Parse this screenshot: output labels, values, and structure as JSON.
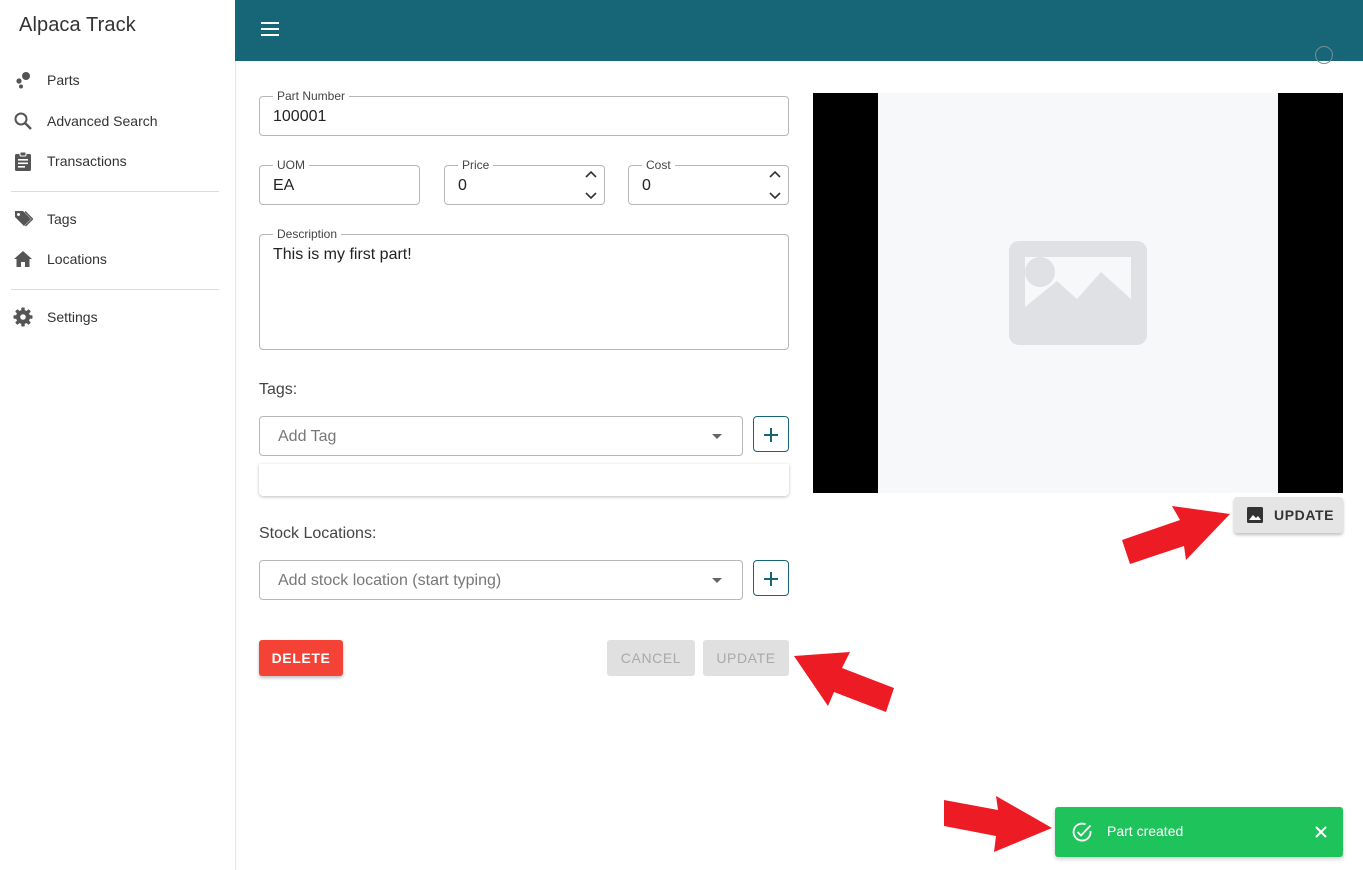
{
  "app": {
    "title": "Alpaca Track"
  },
  "sidebar": {
    "items": [
      {
        "label": "Parts",
        "icon": "parts-icon"
      },
      {
        "label": "Advanced Search",
        "icon": "search-icon"
      },
      {
        "label": "Transactions",
        "icon": "clipboard-icon"
      },
      {
        "label": "Tags",
        "icon": "tag-icon"
      },
      {
        "label": "Locations",
        "icon": "home-icon"
      },
      {
        "label": "Settings",
        "icon": "gear-icon"
      }
    ]
  },
  "form": {
    "part_number": {
      "label": "Part Number",
      "value": "100001"
    },
    "uom": {
      "label": "UOM",
      "value": "EA"
    },
    "price": {
      "label": "Price",
      "value": "0"
    },
    "cost": {
      "label": "Cost",
      "value": "0"
    },
    "description": {
      "label": "Description",
      "value": "This is my first part!"
    },
    "tags_label": "Tags:",
    "tag_placeholder": "Add Tag",
    "stock_label": "Stock Locations:",
    "stock_placeholder": "Add stock location (start typing)",
    "delete_label": "DELETE",
    "cancel_label": "CANCEL",
    "update_label": "UPDATE"
  },
  "image_panel": {
    "update_label": "UPDATE"
  },
  "toast": {
    "message": "Part created"
  },
  "colors": {
    "topbar": "#176678",
    "delete": "#f44336",
    "toast": "#1fc35b",
    "annotation_arrow": "#ed1c24"
  }
}
